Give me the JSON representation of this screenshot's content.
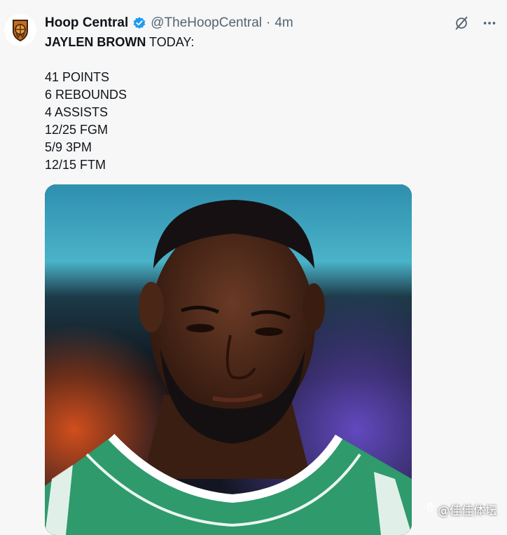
{
  "tweet": {
    "author_name": "Hoop Central",
    "author_handle": "@TheHoopCentral",
    "separator": "·",
    "time_ago": "4m",
    "headline_bold": "JAYLEN BROWN",
    "headline_rest": " TODAY:",
    "stats": [
      "41 POINTS",
      "6 REBOUNDS",
      "4 ASSISTS",
      "12/25 FGM",
      "5/9 3PM",
      "12/15 FTM"
    ],
    "verified_color": "#1d9bf0",
    "icons": {
      "verified": "verified-badge-icon",
      "grok": "grok-icon",
      "more": "more-options-icon"
    }
  },
  "media": {
    "description_icon": "player-photo",
    "jersey_color": "#2f9a6c"
  },
  "watermark": {
    "icon": "paw-icon",
    "text": "@佳佳体坛"
  }
}
